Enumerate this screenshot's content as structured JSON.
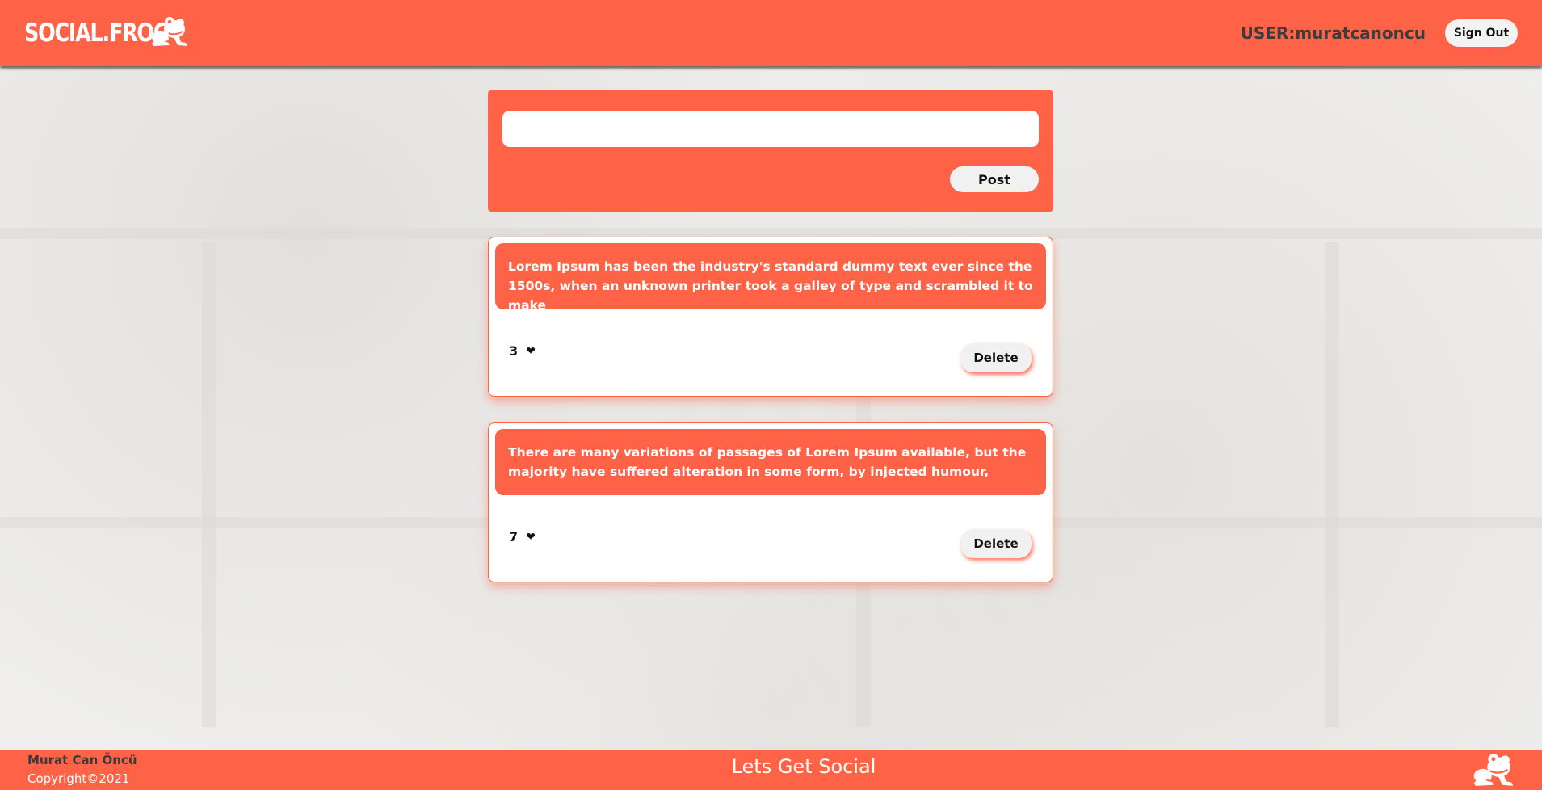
{
  "colors": {
    "accent": "#ff6347",
    "button_bg": "#f1f1f1",
    "card_bg": "#ffffff",
    "user_text": "#3c3c3c"
  },
  "header": {
    "brand": "SOCIAL.FROG",
    "logo_icon": "frog-icon",
    "user_label": "USER:muratcanoncu",
    "signout_label": "Sign Out"
  },
  "composer": {
    "input_value": "",
    "input_placeholder": "",
    "post_label": "Post"
  },
  "posts": [
    {
      "text": "Lorem Ipsum has been the industry's standard dummy text ever since the 1500s, when an unknown printer took a galley of type and scrambled it to make",
      "likes": "3",
      "heart_icon": "❤",
      "delete_label": "Delete"
    },
    {
      "text": "There are many variations of passages of Lorem Ipsum available, but the majority have suffered alteration in some form, by injected humour,",
      "likes": "7",
      "heart_icon": "❤",
      "delete_label": "Delete"
    }
  ],
  "footer": {
    "author": "Murat Can Öncü",
    "copyright": "Copyright©2021",
    "tagline": "Lets Get Social",
    "logo_icon": "frog-icon"
  }
}
